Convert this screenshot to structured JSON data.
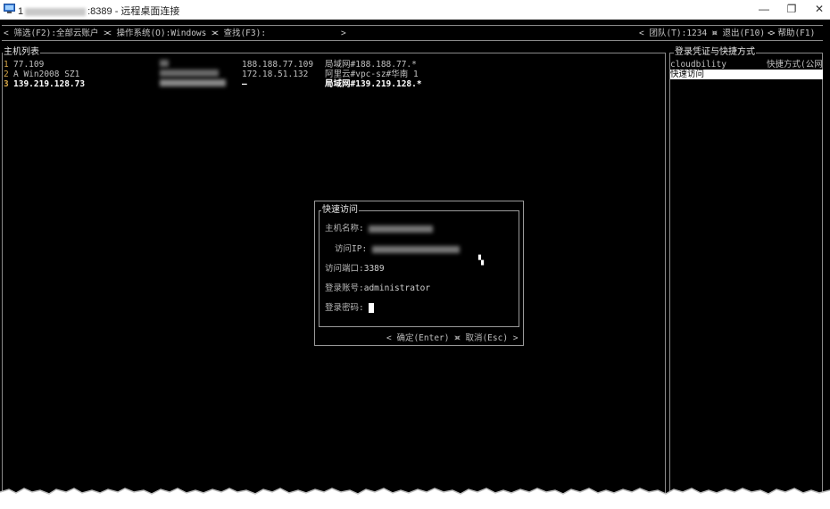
{
  "window": {
    "title_prefix": "1",
    "title_suffix": ":8389 - 远程桌面连接",
    "minimize": "—",
    "maximize": "❐",
    "close": "✕"
  },
  "menubar": {
    "filter": "< 筛选(F2):全部云账户 >",
    "os": "< 操作系统(O):Windows >",
    "search": "< 查找(F3):",
    "search_end": ">",
    "team": "< 团队(T):1234 >",
    "exit": "< 退出(F10) >",
    "help": "< 帮助(F1)"
  },
  "host_list": {
    "title": "主机列表",
    "rows": [
      {
        "num": "1",
        "name": "77.109",
        "public_ip": "188.188.77.109",
        "network": "局域网#188.188.77.*",
        "selected": false
      },
      {
        "num": "2",
        "name": "A Win2008 SZ1",
        "public_ip": "172.18.51.132",
        "network": "阿里云#vpc-sz#华南 1",
        "selected": false
      },
      {
        "num": "3",
        "name": "139.219.128.73",
        "public_ip": "—",
        "network": "局域网#139.219.128.*",
        "selected": true
      }
    ]
  },
  "credentials": {
    "title": "登录凭证与快捷方式",
    "rows": [
      {
        "left": "cloudbility",
        "right": "快捷方式(公网"
      },
      {
        "left": "快速访问",
        "right": ""
      }
    ]
  },
  "dialog": {
    "title": "快速访问",
    "host_label": "主机名称:",
    "ip_label": "访问IP:",
    "port_label": "访问端口:",
    "port_value": "3389",
    "account_label": "登录账号:",
    "account_value": "administrator",
    "password_label": "登录密码:",
    "ok_button": "< 确定(Enter) >",
    "cancel_button": "< 取消(Esc) >"
  },
  "colors": {
    "terminal_bg": "#000000",
    "text": "#c0c0c0",
    "number_accent": "#d8a848",
    "border": "#8a8a8a"
  }
}
